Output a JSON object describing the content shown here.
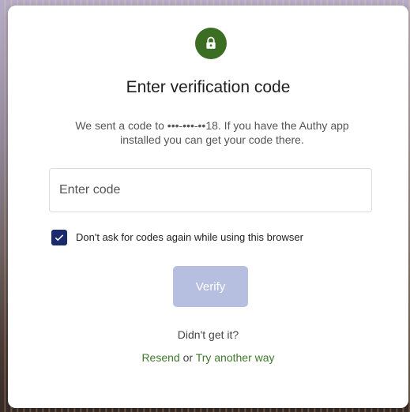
{
  "colors": {
    "brand_green": "#3b6e22",
    "link_green": "#3f7a2a",
    "checkbox_blue": "#1a2a6c",
    "verify_disabled": "#b6bfe0",
    "card_bg": "#ffffff"
  },
  "header": {
    "icon": "lock-icon",
    "title": "Enter verification code",
    "subtitle": "We sent a code to •••-•••-••18. If you have the Authy app installed you can get your code there."
  },
  "form": {
    "code_placeholder": "Enter code",
    "code_value": "",
    "remember_checked": true,
    "remember_label": "Don't ask for codes again while using this browser",
    "verify_label": "Verify"
  },
  "footer": {
    "prompt": "Didn't get it?",
    "resend_label": "Resend",
    "or_text": "or",
    "alt_label": "Try another way"
  }
}
